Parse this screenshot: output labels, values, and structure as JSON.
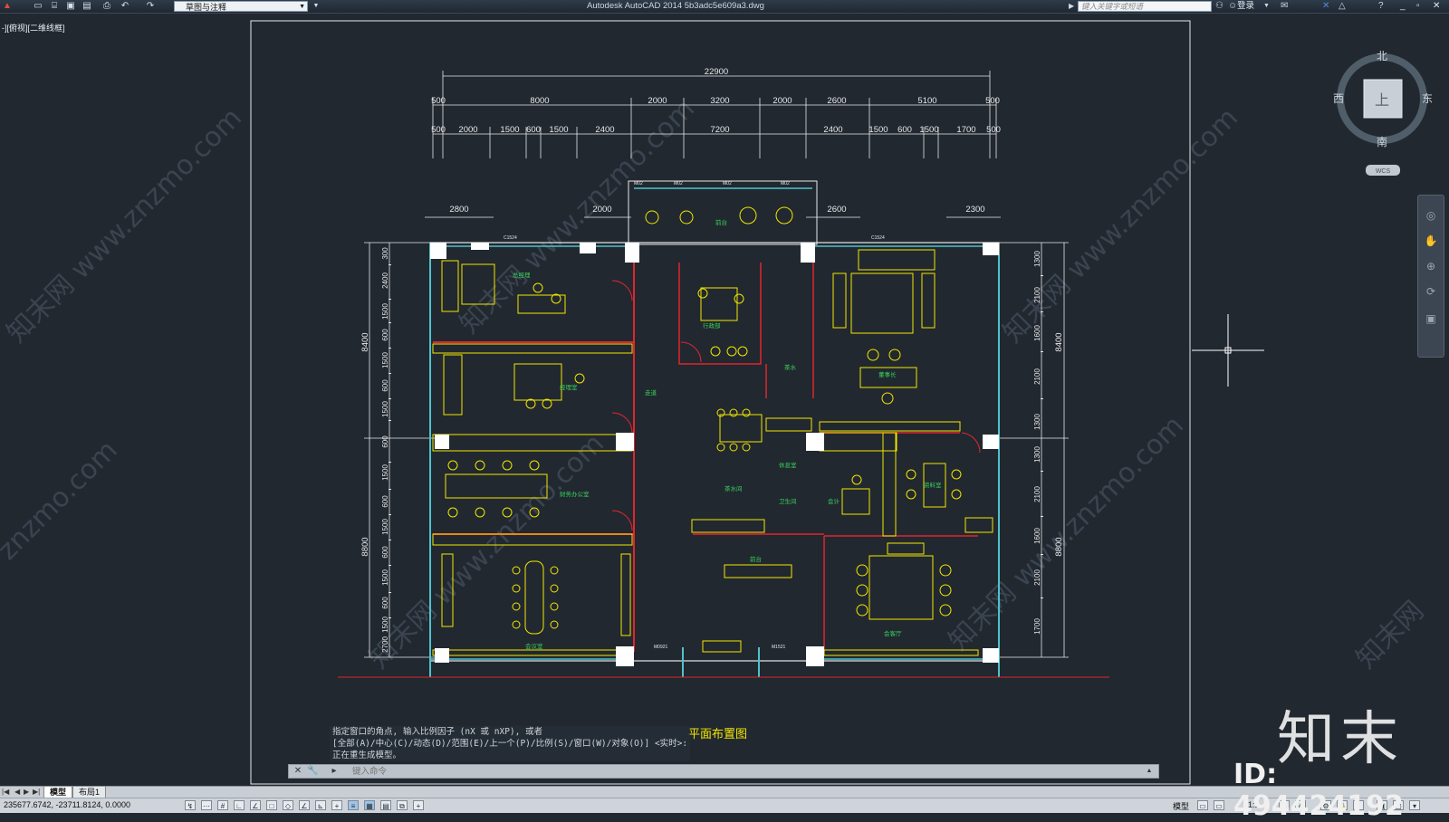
{
  "app": {
    "workspace": "草图与注释",
    "title": "Autodesk AutoCAD 2014    5b3adc5e609a3.dwg",
    "search_placeholder": "键入关键字或短语",
    "login": "登录"
  },
  "viewport": {
    "label": "-][俯视][二维线框]"
  },
  "viewcube": {
    "north": "北",
    "south": "南",
    "east": "东",
    "west": "西",
    "top": "上",
    "wcs": "WCS"
  },
  "drawing": {
    "title": "平面布置图",
    "dims_total": "22900",
    "dims_row1": [
      "500",
      "8000",
      "2000",
      "3200",
      "2000",
      "2600",
      "5100",
      "500"
    ],
    "dims_row2": [
      "500",
      "2000",
      "1500",
      "600",
      "1500",
      "2400",
      "7200",
      "2400",
      "1500",
      "600",
      "1500",
      "1700",
      "500"
    ],
    "dim_left_top": "2800",
    "dim_mid_left": "2000",
    "dim_mid_right": "2600",
    "dim_right_top": "2300",
    "left_vertical": [
      "8400",
      "8800"
    ],
    "right_vertical": [
      "8400",
      "8800"
    ],
    "left_segments": [
      "300",
      "2400",
      "1500",
      "600",
      "1500",
      "600",
      "1500",
      "600",
      "1500",
      "600",
      "1500",
      "600",
      "1500",
      "600",
      "1500",
      "2700"
    ],
    "right_segments": [
      "1300",
      "2100",
      "1600",
      "2100",
      "1300",
      "1300",
      "2100",
      "1600",
      "2100",
      "1700"
    ],
    "door_labels": [
      "C1524",
      "C1524",
      "M0921",
      "M1521",
      "M02",
      "M02",
      "M02",
      "M02"
    ]
  },
  "command": {
    "history": [
      "指定窗口的角点, 输入比例因子 (nX 或 nXP), 或者",
      "[全部(A)/中心(C)/动态(D)/范围(E)/上一个(P)/比例(S)/窗口(W)/对象(O)] <实时>:",
      "正在重生成模型。"
    ],
    "placeholder": "键入命令"
  },
  "tabs": {
    "model": "模型",
    "layout": "布局1"
  },
  "status": {
    "coords": "235677.6742, -23711.8124, 0.0000",
    "model": "模型",
    "scale": "1:1"
  },
  "watermark": {
    "logo": "知末",
    "id": "ID: 494424192",
    "site": "知末网 www.znzmo.com"
  }
}
